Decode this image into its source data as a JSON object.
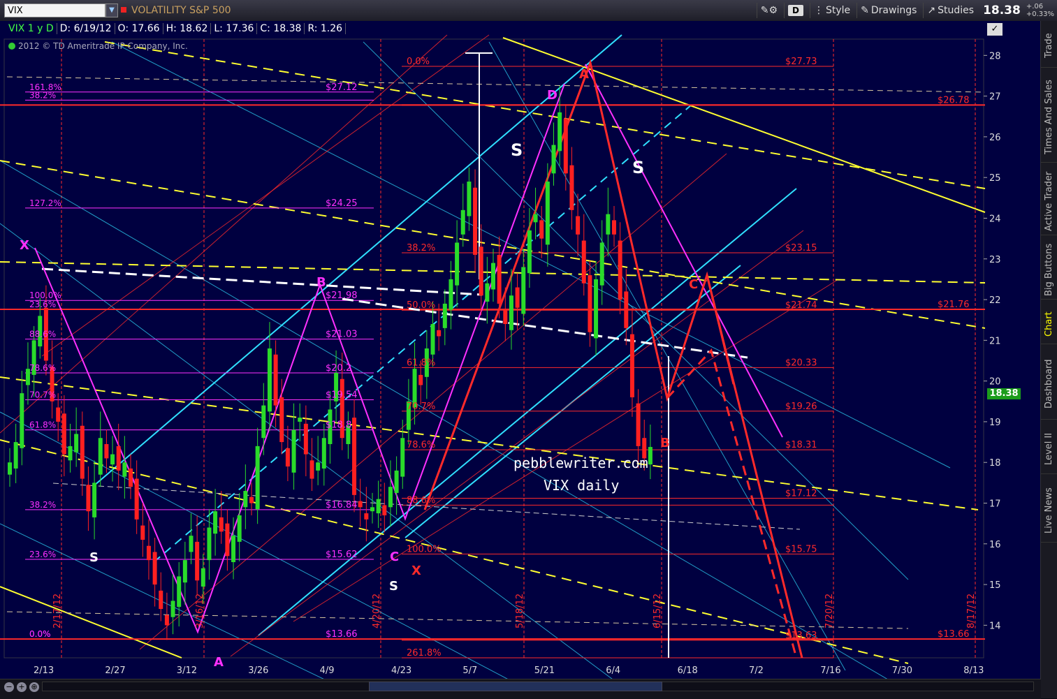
{
  "toolbar": {
    "symbol": "VIX",
    "description": "VOLATILITY S&P 500",
    "d_button": "D",
    "style_label": "Style",
    "drawings_label": "Drawings",
    "studies_label": "Studies",
    "last_price": "18.38",
    "change": "+.06",
    "change_pct": "+0.33%"
  },
  "info": {
    "ticker": "VIX 1 y D",
    "date": "D: 6/19/12",
    "open": "O: 17.66",
    "high": "H: 18.62",
    "low": "L: 17.36",
    "close": "C: 18.38",
    "range": "R: 1.26"
  },
  "copyright": "2012 © TD Ameritrade IP Company, Inc.",
  "watermark": {
    "line1": "pebblewriter.com",
    "line2": "VIX daily"
  },
  "current_price_tag": "18.38",
  "side_tabs": [
    "Trade",
    "Times And Sales",
    "Active Trader",
    "Big Buttons",
    "Chart",
    "Dashboard",
    "Level II",
    "Live News"
  ],
  "active_tab": "Chart",
  "colors": {
    "background": "#000040",
    "fib_red": "#ff2a2a",
    "magenta": "#ff30ff",
    "cyan": "#30e0ff",
    "yellow": "#ffff30",
    "up_candle": "#2adb2a",
    "down_candle": "#ff2020"
  },
  "chart_data": {
    "type": "candlestick",
    "ylim": [
      13.2,
      28.4
    ],
    "y_ticks": [
      14,
      15,
      16,
      17,
      18,
      19,
      20,
      21,
      22,
      23,
      24,
      25,
      26,
      27,
      28
    ],
    "x_ticks": [
      "2/13",
      "2/27",
      "3/12",
      "3/26",
      "4/9",
      "4/23",
      "5/7",
      "5/21",
      "6/4",
      "6/18",
      "7/2",
      "7/16",
      "7/30",
      "8/13"
    ],
    "date_markers": [
      "2/17/12",
      "3/16/12",
      "4/20/12",
      "5/18/12",
      "6/15/12",
      "7/20/12",
      "8/17/12"
    ],
    "fib_left_labels": [
      {
        "pct": "161.8%",
        "price": "$27.12",
        "y": 27.1
      },
      {
        "pct": "38.2%",
        "price": "",
        "y": 26.9
      },
      {
        "pct": "127.2%",
        "price": "$24.25",
        "y": 24.25
      },
      {
        "pct": "100.0%",
        "price": "$21.98",
        "y": 21.98
      },
      {
        "pct": "23.6%",
        "price": "",
        "y": 21.76
      },
      {
        "pct": "88.6%",
        "price": "$21.03",
        "y": 21.03
      },
      {
        "pct": "78.6%",
        "price": "$20.2",
        "y": 20.2
      },
      {
        "pct": "70.7%",
        "price": "$19.54",
        "y": 19.54
      },
      {
        "pct": "61.8%",
        "price": "$18.8",
        "y": 18.8
      },
      {
        "pct": "38.2%",
        "price": "$16.84",
        "y": 16.84
      },
      {
        "pct": "23.6%",
        "price": "$15.62",
        "y": 15.62
      },
      {
        "pct": "0.0%",
        "price": "$13.66",
        "y": 13.66
      },
      {
        "pct": "0.0%",
        "price": "",
        "y": 13.66
      }
    ],
    "fib_right_labels": [
      {
        "pct": "0.0%",
        "price": "$27.73",
        "y": 27.73
      },
      {
        "pct": "",
        "price": "$26.78",
        "y": 26.78
      },
      {
        "pct": "38.2%",
        "price": "$23.15",
        "y": 23.15
      },
      {
        "pct": "50.0%",
        "price": "$21.74",
        "y": 21.74
      },
      {
        "pct": "",
        "price": "$21.76",
        "y": 21.76
      },
      {
        "pct": "61.8%",
        "price": "$20.33",
        "y": 20.33
      },
      {
        "pct": "70.7%",
        "price": "$19.26",
        "y": 19.26
      },
      {
        "pct": "78.6%",
        "price": "$18.31",
        "y": 18.31
      },
      {
        "pct": "",
        "price": "$17.12",
        "y": 17.12
      },
      {
        "pct": "88.6%",
        "price": "",
        "y": 16.95
      },
      {
        "pct": "100.0%",
        "price": "$15.75",
        "y": 15.75
      },
      {
        "pct": "",
        "price": "$13.63",
        "y": 13.63
      },
      {
        "pct": "",
        "price": "$13.66",
        "y": 13.66
      },
      {
        "pct": "261.8%",
        "price": "",
        "y": 13.2
      }
    ],
    "pattern_labels": [
      {
        "text": "X",
        "color": "magenta"
      },
      {
        "text": "A",
        "color": "magenta"
      },
      {
        "text": "B",
        "color": "magenta"
      },
      {
        "text": "C",
        "color": "magenta"
      },
      {
        "text": "D",
        "color": "magenta"
      },
      {
        "text": "X",
        "color": "red"
      },
      {
        "text": "A",
        "color": "red"
      },
      {
        "text": "B",
        "color": "red"
      },
      {
        "text": "C",
        "color": "red"
      },
      {
        "text": "S",
        "color": "white"
      },
      {
        "text": "S",
        "color": "white"
      },
      {
        "text": "S",
        "color": "white"
      },
      {
        "text": "S",
        "color": "white"
      }
    ]
  }
}
